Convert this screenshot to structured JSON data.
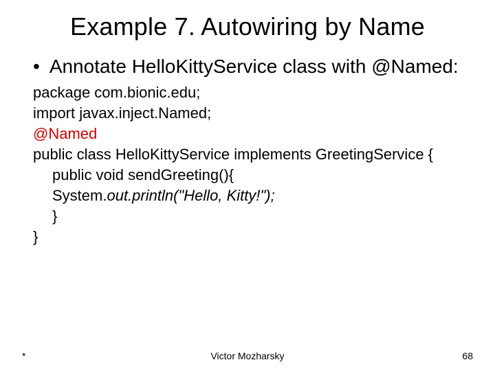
{
  "title": "Example 7. Autowiring by Name",
  "bullet": "Annotate HelloKittyService class with @Named:",
  "code": {
    "l1": "package com.bionic.edu;",
    "l2": "import javax.inject.Named;",
    "l3": "@Named",
    "l4": "public class HelloKittyService implements GreetingService {",
    "l5": "public void sendGreeting(){",
    "l6a": "System.",
    "l6b": "out.println(\"Hello, Kitty!\");",
    "l7": "}",
    "l8": "}"
  },
  "footer": {
    "left": "*",
    "center": "Victor Mozharsky",
    "right": "68"
  }
}
